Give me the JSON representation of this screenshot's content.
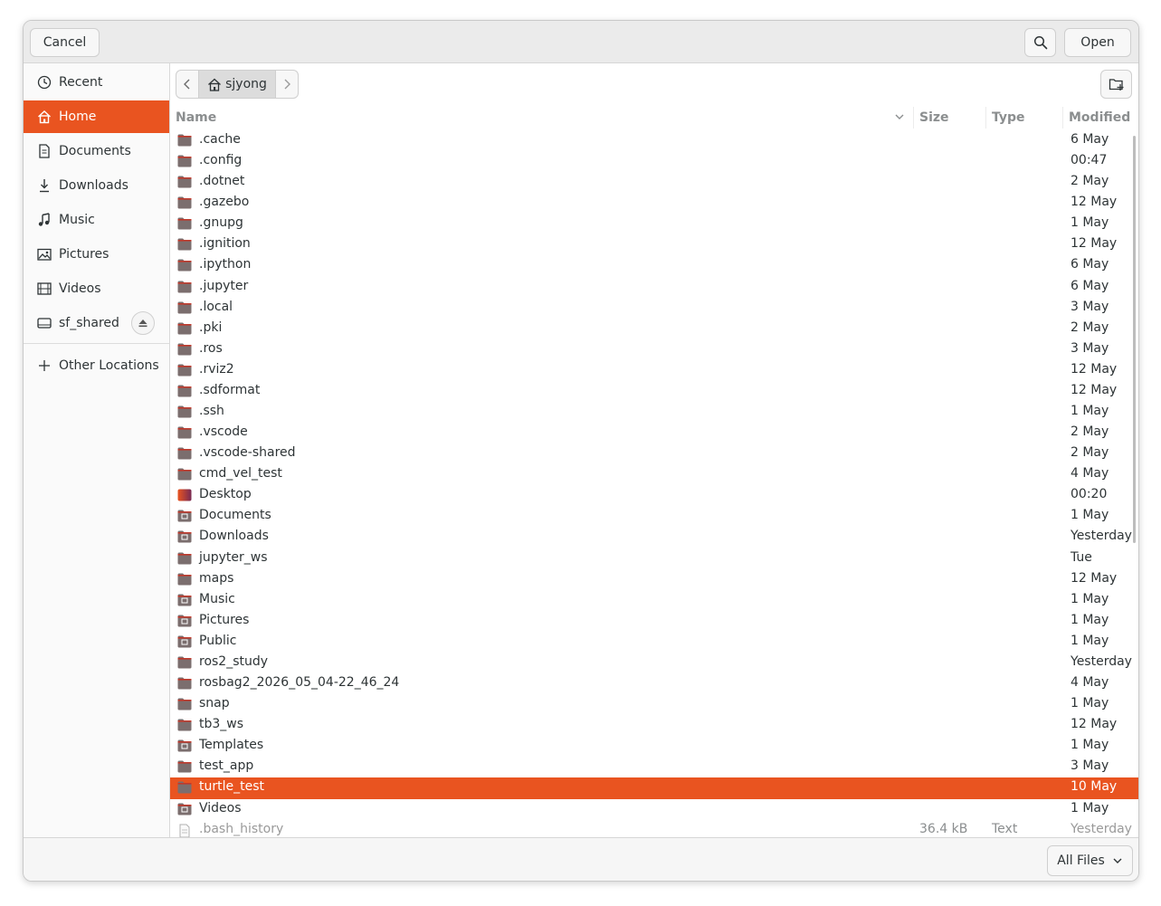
{
  "header": {
    "cancel_label": "Cancel",
    "open_label": "Open"
  },
  "sidebar": {
    "items": [
      {
        "label": "Recent",
        "icon": "clock-icon"
      },
      {
        "label": "Home",
        "icon": "home-icon"
      },
      {
        "label": "Documents",
        "icon": "document-icon"
      },
      {
        "label": "Downloads",
        "icon": "download-icon"
      },
      {
        "label": "Music",
        "icon": "music-icon"
      },
      {
        "label": "Pictures",
        "icon": "picture-icon"
      },
      {
        "label": "Videos",
        "icon": "video-icon"
      },
      {
        "label": "sf_shared",
        "icon": "drive-icon"
      },
      {
        "label": "Other Locations",
        "icon": "plus-icon"
      }
    ],
    "active_index": 1
  },
  "pathbar": {
    "current": "sjyong"
  },
  "columns": {
    "name": "Name",
    "size": "Size",
    "type": "Type",
    "modified": "Modified"
  },
  "files": [
    {
      "name": ".cache",
      "size": "",
      "type": "",
      "modified": "6 May"
    },
    {
      "name": ".config",
      "size": "",
      "type": "",
      "modified": "00:47"
    },
    {
      "name": ".dotnet",
      "size": "",
      "type": "",
      "modified": "2 May"
    },
    {
      "name": ".gazebo",
      "size": "",
      "type": "",
      "modified": "12 May"
    },
    {
      "name": ".gnupg",
      "size": "",
      "type": "",
      "modified": "1 May"
    },
    {
      "name": ".ignition",
      "size": "",
      "type": "",
      "modified": "12 May"
    },
    {
      "name": ".ipython",
      "size": "",
      "type": "",
      "modified": "6 May"
    },
    {
      "name": ".jupyter",
      "size": "",
      "type": "",
      "modified": "6 May"
    },
    {
      "name": ".local",
      "size": "",
      "type": "",
      "modified": "3 May"
    },
    {
      "name": ".pki",
      "size": "",
      "type": "",
      "modified": "2 May"
    },
    {
      "name": ".ros",
      "size": "",
      "type": "",
      "modified": "3 May"
    },
    {
      "name": ".rviz2",
      "size": "",
      "type": "",
      "modified": "12 May"
    },
    {
      "name": ".sdformat",
      "size": "",
      "type": "",
      "modified": "12 May"
    },
    {
      "name": ".ssh",
      "size": "",
      "type": "",
      "modified": "1 May"
    },
    {
      "name": ".vscode",
      "size": "",
      "type": "",
      "modified": "2 May"
    },
    {
      "name": ".vscode-shared",
      "size": "",
      "type": "",
      "modified": "2 May"
    },
    {
      "name": "cmd_vel_test",
      "size": "",
      "type": "",
      "modified": "4 May"
    },
    {
      "name": "Desktop",
      "size": "",
      "type": "",
      "modified": "00:20"
    },
    {
      "name": "Documents",
      "size": "",
      "type": "",
      "modified": "1 May"
    },
    {
      "name": "Downloads",
      "size": "",
      "type": "",
      "modified": "Yesterday"
    },
    {
      "name": "jupyter_ws",
      "size": "",
      "type": "",
      "modified": "Tue"
    },
    {
      "name": "maps",
      "size": "",
      "type": "",
      "modified": "12 May"
    },
    {
      "name": "Music",
      "size": "",
      "type": "",
      "modified": "1 May"
    },
    {
      "name": "Pictures",
      "size": "",
      "type": "",
      "modified": "1 May"
    },
    {
      "name": "Public",
      "size": "",
      "type": "",
      "modified": "1 May"
    },
    {
      "name": "ros2_study",
      "size": "",
      "type": "",
      "modified": "Yesterday"
    },
    {
      "name": "rosbag2_2026_05_04-22_46_24",
      "size": "",
      "type": "",
      "modified": "4 May"
    },
    {
      "name": "snap",
      "size": "",
      "type": "",
      "modified": "1 May"
    },
    {
      "name": "tb3_ws",
      "size": "",
      "type": "",
      "modified": "12 May"
    },
    {
      "name": "Templates",
      "size": "",
      "type": "",
      "modified": "1 May"
    },
    {
      "name": "test_app",
      "size": "",
      "type": "",
      "modified": "3 May"
    },
    {
      "name": "turtle_test",
      "size": "",
      "type": "",
      "modified": "10 May"
    },
    {
      "name": "Videos",
      "size": "",
      "type": "",
      "modified": "1 May"
    },
    {
      "name": ".bash_history",
      "size": "36.4 kB",
      "type": "Text",
      "modified": "Yesterday"
    }
  ],
  "selected_file": "turtle_test",
  "footer": {
    "filter_label": "All Files"
  },
  "colors": {
    "accent": "#e95420",
    "folder": "#7b6e6e",
    "folder_tab": "#c0392b"
  }
}
